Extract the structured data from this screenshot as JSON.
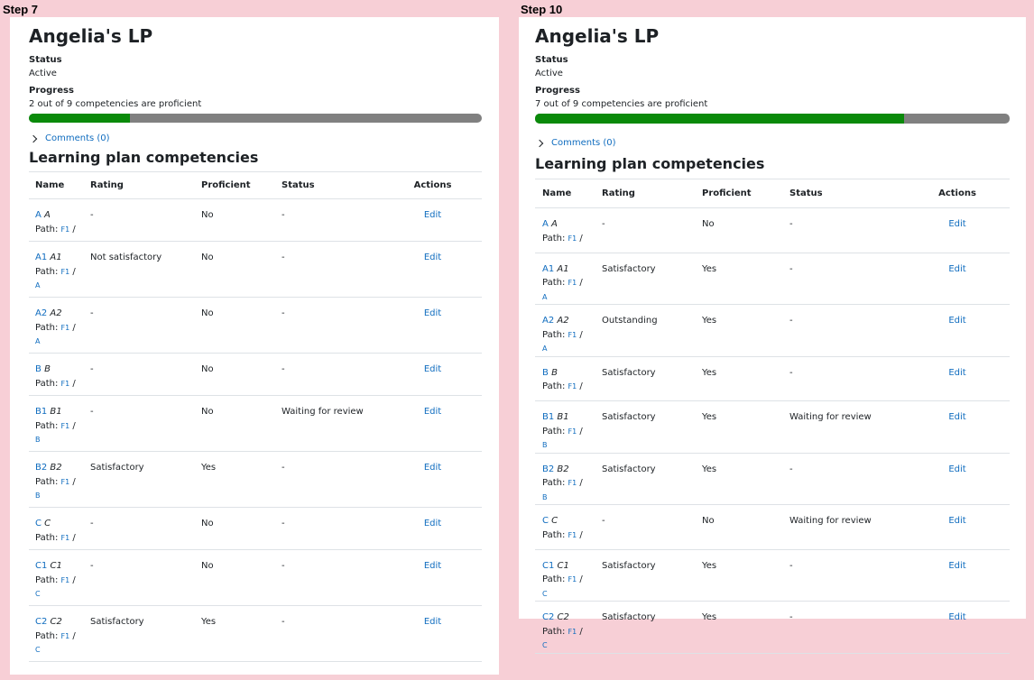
{
  "panels": [
    {
      "step_label": "Step 7",
      "title": "Angelia's LP",
      "status_label": "Status",
      "status_value": "Active",
      "progress_label": "Progress",
      "progress_text": "2 out of 9 competencies are proficient",
      "progress_fraction": 0.2222,
      "comments_link": "Comments (0)",
      "section_title": "Learning plan competencies",
      "columns": [
        "Name",
        "Rating",
        "Proficient",
        "Status",
        "Actions"
      ],
      "path_label": "Path:",
      "rows": [
        {
          "short": "A",
          "name": "A",
          "path_root": "F1",
          "path_parent": "",
          "rating": "-",
          "proficient": "No",
          "status": "-",
          "action": "Edit"
        },
        {
          "short": "A1",
          "name": "A1",
          "path_root": "F1",
          "path_parent": "A",
          "rating": "Not satisfactory",
          "proficient": "No",
          "status": "-",
          "action": "Edit"
        },
        {
          "short": "A2",
          "name": "A2",
          "path_root": "F1",
          "path_parent": "A",
          "rating": "-",
          "proficient": "No",
          "status": "-",
          "action": "Edit"
        },
        {
          "short": "B",
          "name": "B",
          "path_root": "F1",
          "path_parent": "",
          "rating": "-",
          "proficient": "No",
          "status": "-",
          "action": "Edit"
        },
        {
          "short": "B1",
          "name": "B1",
          "path_root": "F1",
          "path_parent": "B",
          "rating": "-",
          "proficient": "No",
          "status": "Waiting for review",
          "action": "Edit"
        },
        {
          "short": "B2",
          "name": "B2",
          "path_root": "F1",
          "path_parent": "B",
          "rating": "Satisfactory",
          "proficient": "Yes",
          "status": "-",
          "action": "Edit"
        },
        {
          "short": "C",
          "name": "C",
          "path_root": "F1",
          "path_parent": "",
          "rating": "-",
          "proficient": "No",
          "status": "-",
          "action": "Edit"
        },
        {
          "short": "C1",
          "name": "C1",
          "path_root": "F1",
          "path_parent": "C",
          "rating": "-",
          "proficient": "No",
          "status": "-",
          "action": "Edit"
        },
        {
          "short": "C2",
          "name": "C2",
          "path_root": "F1",
          "path_parent": "C",
          "rating": "Satisfactory",
          "proficient": "Yes",
          "status": "-",
          "action": "Edit"
        }
      ]
    },
    {
      "step_label": "Step 10",
      "title": "Angelia's LP",
      "status_label": "Status",
      "status_value": "Active",
      "progress_label": "Progress",
      "progress_text": "7 out of 9 competencies are proficient",
      "progress_fraction": 0.7778,
      "comments_link": "Comments (0)",
      "section_title": "Learning plan competencies",
      "columns": [
        "Name",
        "Rating",
        "Proficient",
        "Status",
        "Actions"
      ],
      "path_label": "Path:",
      "rows": [
        {
          "short": "A",
          "name": "A",
          "path_root": "F1",
          "path_parent": "",
          "rating": "-",
          "proficient": "No",
          "status": "-",
          "action": "Edit"
        },
        {
          "short": "A1",
          "name": "A1",
          "path_root": "F1",
          "path_parent": "A",
          "rating": "Satisfactory",
          "proficient": "Yes",
          "status": "-",
          "action": "Edit"
        },
        {
          "short": "A2",
          "name": "A2",
          "path_root": "F1",
          "path_parent": "A",
          "rating": "Outstanding",
          "proficient": "Yes",
          "status": "-",
          "action": "Edit"
        },
        {
          "short": "B",
          "name": "B",
          "path_root": "F1",
          "path_parent": "",
          "rating": "Satisfactory",
          "proficient": "Yes",
          "status": "-",
          "action": "Edit"
        },
        {
          "short": "B1",
          "name": "B1",
          "path_root": "F1",
          "path_parent": "B",
          "rating": "Satisfactory",
          "proficient": "Yes",
          "status": "Waiting for review",
          "action": "Edit"
        },
        {
          "short": "B2",
          "name": "B2",
          "path_root": "F1",
          "path_parent": "B",
          "rating": "Satisfactory",
          "proficient": "Yes",
          "status": "-",
          "action": "Edit"
        },
        {
          "short": "C",
          "name": "C",
          "path_root": "F1",
          "path_parent": "",
          "rating": "-",
          "proficient": "No",
          "status": "Waiting for review",
          "action": "Edit"
        },
        {
          "short": "C1",
          "name": "C1",
          "path_root": "F1",
          "path_parent": "C",
          "rating": "Satisfactory",
          "proficient": "Yes",
          "status": "-",
          "action": "Edit"
        },
        {
          "short": "C2",
          "name": "C2",
          "path_root": "F1",
          "path_parent": "C",
          "rating": "Satisfactory",
          "proficient": "Yes",
          "status": "-",
          "action": "Edit"
        }
      ]
    }
  ]
}
